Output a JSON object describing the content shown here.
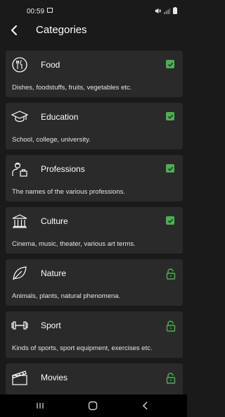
{
  "status_bar": {
    "time": "00:59",
    "icons": [
      "image-icon",
      "mute-icon",
      "signal-icon",
      "battery-icon"
    ]
  },
  "header": {
    "title": "Categories",
    "back_icon": "back-arrow-icon"
  },
  "categories": [
    {
      "title": "Food",
      "description": "Dishes, foodstuffs, fruits, vegetables etc.",
      "icon": "food-icon",
      "status": "checked"
    },
    {
      "title": "Education",
      "description": "School, college, university.",
      "icon": "graduation-cap-icon",
      "status": "checked"
    },
    {
      "title": "Professions",
      "description": "The names of the various professions.",
      "icon": "worker-icon",
      "status": "checked"
    },
    {
      "title": "Culture",
      "description": "Cinema, music, theater, various art terms.",
      "icon": "museum-icon",
      "status": "checked"
    },
    {
      "title": "Nature",
      "description": "Animals, plants, natural phenomena.",
      "icon": "leaf-icon",
      "status": "locked"
    },
    {
      "title": "Sport",
      "description": "Kinds of sports, sport equipment, exercises etc.",
      "icon": "dumbbell-icon",
      "status": "locked"
    },
    {
      "title": "Movies",
      "description": "",
      "icon": "clapperboard-icon",
      "status": "locked"
    }
  ],
  "colors": {
    "background": "#1a1a1a",
    "card": "#2a2a2a",
    "accent_green": "#4caf50",
    "nav_bar": "#000000"
  },
  "nav_bar": {
    "buttons": [
      "recent-apps-icon",
      "home-icon",
      "back-icon"
    ]
  }
}
